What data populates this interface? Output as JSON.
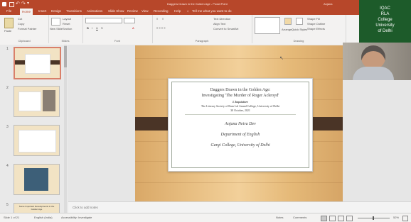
{
  "app": {
    "window_title": "Daggers Drawn in the Golden Age - PowerPoint",
    "user": "Anjana"
  },
  "tabs": [
    {
      "label": "File"
    },
    {
      "label": "Home"
    },
    {
      "label": "Insert"
    },
    {
      "label": "Design"
    },
    {
      "label": "Transitions"
    },
    {
      "label": "Animations"
    },
    {
      "label": "Slide Show"
    },
    {
      "label": "Review"
    },
    {
      "label": "View"
    },
    {
      "label": "Recording"
    },
    {
      "label": "Help"
    }
  ],
  "tell_me": "Tell me what you want to do",
  "ribbon": {
    "groups": [
      "Clipboard",
      "Slides",
      "Font",
      "Paragraph",
      "Drawing"
    ],
    "clipboard": {
      "paste": "Paste",
      "cut": "Cut",
      "copy": "Copy",
      "format_painter": "Format Painter"
    },
    "slides": {
      "new_slide": "New Slide",
      "layout": "Layout",
      "reset": "Reset",
      "section": "Section"
    },
    "paragraph": {
      "text_direction": "Text Direction",
      "align_text": "Align Text",
      "convert_smartart": "Convert to SmartArt"
    },
    "drawing": {
      "arrange": "Arrange",
      "quick_styles": "Quick Styles",
      "shape_fill": "Shape Fill",
      "shape_outline": "Shape Outline",
      "shape_effects": "Shape Effects"
    }
  },
  "thumbnails": [
    {
      "number": "1"
    },
    {
      "number": "2"
    },
    {
      "number": "3"
    },
    {
      "number": "4"
    },
    {
      "number": "5"
    }
  ],
  "thumb5_text": "Some Important Developments in the Golden Age",
  "slide": {
    "title_line1": "Daggers Drawn in the Golden Age:",
    "title_line2": "Investigating 'The Murder of Roger Ackroyd'",
    "tag": "L'Inquisitore",
    "org_line": "The Literary Society of Ram Lal Anand College, University of Delhi",
    "date": "30 October, 2021",
    "speaker": "Anjana Neira Dev",
    "department": "Department of English",
    "college": "Gargi College, University of Delhi"
  },
  "notes_placeholder": "Click to add notes",
  "status": {
    "slide_counter": "Slide 1 of 21",
    "language": "English (India)",
    "accessibility": "Accessibility: Investigate",
    "notes": "Notes",
    "comments": "Comments",
    "zoom": "52%"
  },
  "overlay": {
    "logo_lines": [
      "IQAC",
      "RLA",
      "College",
      "University",
      "of Delhi"
    ]
  },
  "colors": {
    "accent": "#b7472a",
    "logo_bg": "#1d5b2a",
    "band": "#4a3426"
  }
}
